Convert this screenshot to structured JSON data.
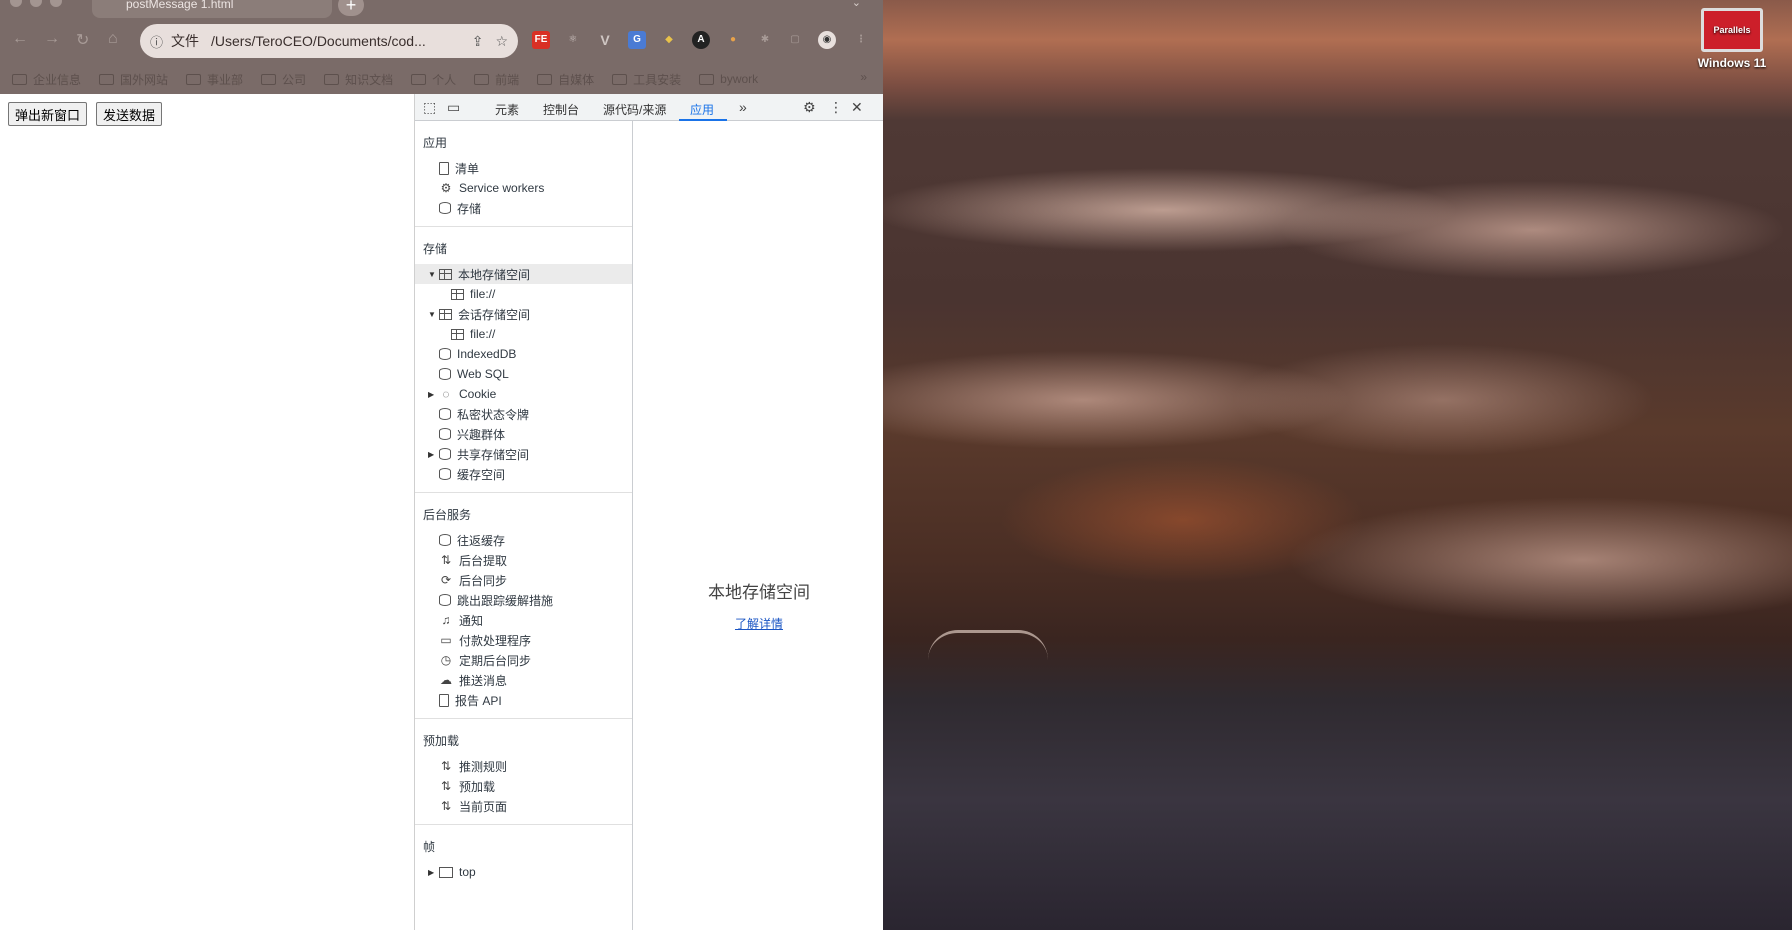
{
  "browser": {
    "tab_title": "postMessage 1.html",
    "omnibox": {
      "scheme_label": "文件",
      "url": "/Users/TeroCEO/Documents/cod..."
    },
    "extensions": [
      "FE",
      "V",
      "A"
    ],
    "bookmarks": [
      "企业信息",
      "国外网站",
      "事业部",
      "公司",
      "知识文档",
      "个人",
      "前端",
      "自媒体",
      "工具安装",
      "bywork"
    ],
    "bookmarks_more": "»"
  },
  "page": {
    "buttons": [
      "弹出新窗口",
      "发送数据"
    ]
  },
  "devtools": {
    "tabs": [
      "元素",
      "控制台",
      "源代码/来源",
      "应用"
    ],
    "active_tab": "应用",
    "sidebar": {
      "app": {
        "title": "应用",
        "items": [
          {
            "label": "清单",
            "icon": "document-icon"
          },
          {
            "label": "Service workers",
            "icon": "gears-icon"
          },
          {
            "label": "存储",
            "icon": "database-icon"
          }
        ]
      },
      "storage": {
        "title": "存储",
        "items": [
          {
            "label": "本地存储空间",
            "icon": "table-icon"
          },
          {
            "label": "file://",
            "icon": "table-icon"
          },
          {
            "label": "会话存储空间",
            "icon": "table-icon"
          },
          {
            "label": "file://",
            "icon": "table-icon"
          },
          {
            "label": "IndexedDB",
            "icon": "database-icon"
          },
          {
            "label": "Web SQL",
            "icon": "database-icon"
          },
          {
            "label": "Cookie",
            "icon": "cookie-icon"
          },
          {
            "label": "私密状态令牌",
            "icon": "database-icon"
          },
          {
            "label": "兴趣群体",
            "icon": "database-icon"
          },
          {
            "label": "共享存储空间",
            "icon": "database-icon"
          },
          {
            "label": "缓存空间",
            "icon": "database-icon"
          }
        ]
      },
      "background": {
        "title": "后台服务",
        "items": [
          {
            "label": "往返缓存",
            "icon": "database-icon"
          },
          {
            "label": "后台提取",
            "icon": "arrows-icon"
          },
          {
            "label": "后台同步",
            "icon": "sync-icon"
          },
          {
            "label": "跳出跟踪缓解措施",
            "icon": "database-icon"
          },
          {
            "label": "通知",
            "icon": "bell-icon"
          },
          {
            "label": "付款处理程序",
            "icon": "card-icon"
          },
          {
            "label": "定期后台同步",
            "icon": "clock-icon"
          },
          {
            "label": "推送消息",
            "icon": "cloud-icon"
          },
          {
            "label": "报告 API",
            "icon": "document-icon"
          }
        ]
      },
      "preload": {
        "title": "预加载",
        "items": [
          {
            "label": "推测规则",
            "icon": "arrows-icon"
          },
          {
            "label": "预加载",
            "icon": "arrows-icon"
          },
          {
            "label": "当前页面",
            "icon": "arrows-icon"
          }
        ]
      },
      "frames": {
        "title": "帧",
        "items": [
          {
            "label": "top",
            "icon": "frame-icon"
          }
        ]
      }
    },
    "main": {
      "title": "本地存储空间",
      "link": "了解详情"
    }
  },
  "desktop": {
    "icon_brand": "Parallels",
    "icon_label": "Windows 11"
  }
}
